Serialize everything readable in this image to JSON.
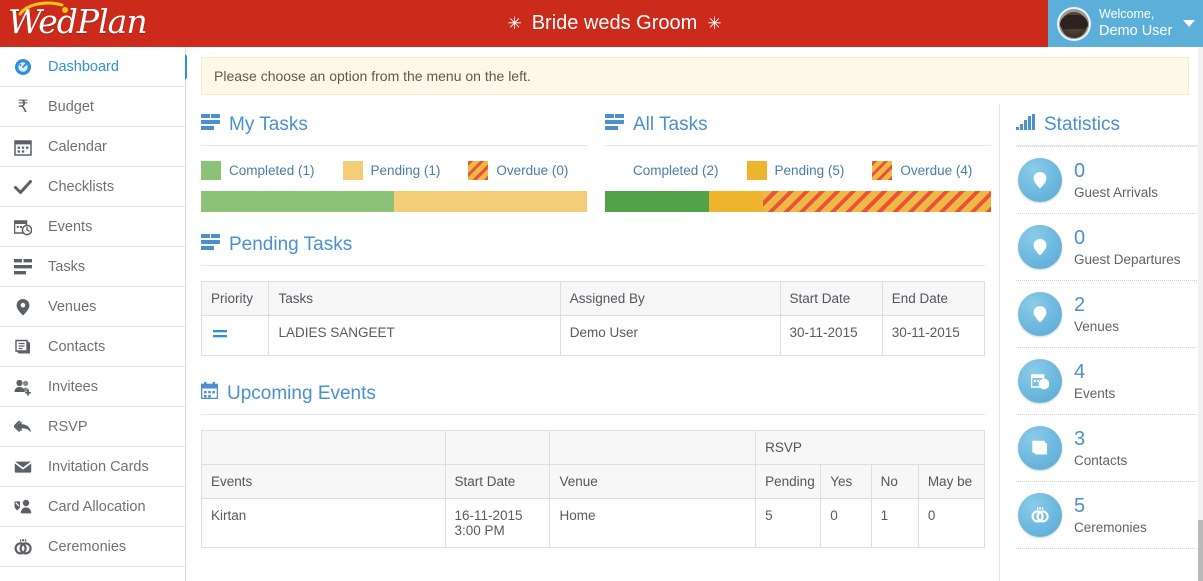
{
  "brand": {
    "logo_text": "WedPlan"
  },
  "header": {
    "banner_text": "Bride weds Groom",
    "sparkle_left": "✳",
    "sparkle_right": "✳",
    "welcome_label": "Welcome,",
    "user_name": "Demo User",
    "accent_red": "#cc2a1a",
    "user_bg_blue": "#5bafd8"
  },
  "sidebar": {
    "items": [
      {
        "label": "Dashboard",
        "icon": "dashboard-icon",
        "active": true
      },
      {
        "label": "Budget",
        "icon": "rupee-icon",
        "active": false
      },
      {
        "label": "Calendar",
        "icon": "calendar-icon",
        "active": false
      },
      {
        "label": "Checklists",
        "icon": "check-icon",
        "active": false
      },
      {
        "label": "Events",
        "icon": "calendar-clock-icon",
        "active": false
      },
      {
        "label": "Tasks",
        "icon": "tasks-list-icon",
        "active": false
      },
      {
        "label": "Venues",
        "icon": "map-pin-icon",
        "active": false
      },
      {
        "label": "Contacts",
        "icon": "address-book-icon",
        "active": false
      },
      {
        "label": "Invitees",
        "icon": "users-add-icon",
        "active": false
      },
      {
        "label": "RSVP",
        "icon": "reply-all-icon",
        "active": false
      },
      {
        "label": "Invitation Cards",
        "icon": "envelope-icon",
        "active": false
      },
      {
        "label": "Card Allocation",
        "icon": "user-share-icon",
        "active": false
      },
      {
        "label": "Ceremonies",
        "icon": "rings-icon",
        "active": false
      }
    ]
  },
  "alert": {
    "message": "Please choose an option from the menu on the left."
  },
  "my_tasks": {
    "title": "My Tasks",
    "icon": "tasks-list-icon",
    "legend": [
      {
        "label": "Completed (1)",
        "color": "#8cc278",
        "style": "solid"
      },
      {
        "label": "Pending (1)",
        "color": "#f3cd77",
        "style": "solid"
      },
      {
        "label": "Overdue (0)",
        "color": "#f0b844",
        "style": "striped"
      }
    ],
    "bar": [
      {
        "name": "completed",
        "percent": 50,
        "color": "#8cc278",
        "style": "solid"
      },
      {
        "name": "pending",
        "percent": 50,
        "color": "#f3cd77",
        "style": "solid"
      },
      {
        "name": "overdue",
        "percent": 0,
        "color": "#f0b844",
        "style": "striped"
      }
    ]
  },
  "all_tasks": {
    "title": "All Tasks",
    "icon": "tasks-list-icon",
    "legend": [
      {
        "label": "Completed (2)",
        "color": "#4fa council",
        "style": "solid"
      },
      {
        "label": "Pending (5)",
        "color": "#efb42e",
        "style": "solid"
      },
      {
        "label": "Overdue (4)",
        "color": "#f0b844",
        "style": "striped"
      }
    ],
    "bar": [
      {
        "name": "completed",
        "percent": 27,
        "color": "#52a247",
        "style": "solid"
      },
      {
        "name": "pending",
        "percent": 14,
        "color": "#efb42e",
        "style": "solid"
      },
      {
        "name": "overdue",
        "percent": 59,
        "color": "#f0b844",
        "style": "striped"
      }
    ]
  },
  "pending_tasks": {
    "title": "Pending Tasks",
    "icon": "tasks-list-icon",
    "columns": [
      "Priority",
      "Tasks",
      "Assigned By",
      "Start Date",
      "End Date"
    ],
    "rows": [
      {
        "priority_icon": "medium-priority-icon",
        "task": "LADIES SANGEET",
        "assigned_by": "Demo User",
        "start_date": "30-11-2015",
        "end_date": "30-11-2015"
      }
    ]
  },
  "upcoming_events": {
    "title": "Upcoming Events",
    "icon": "calendar-icon",
    "group_header": "RSVP",
    "columns": [
      "Events",
      "Start Date",
      "Venue",
      "Pending",
      "Yes",
      "No",
      "May be"
    ],
    "rows": [
      {
        "event": "Kirtan",
        "start_date": "16-11-2015\n3:00 PM",
        "venue": "Home",
        "pending": "5",
        "yes": "0",
        "no": "1",
        "maybe": "0"
      }
    ]
  },
  "statistics": {
    "title": "Statistics",
    "icon": "bar-chart-icon",
    "items": [
      {
        "value": "0",
        "label": "Guest Arrivals",
        "icon": "map-pin-icon"
      },
      {
        "value": "0",
        "label": "Guest Departures",
        "icon": "map-pin-icon"
      },
      {
        "value": "2",
        "label": "Venues",
        "icon": "map-pin-icon"
      },
      {
        "value": "4",
        "label": "Events",
        "icon": "calendar-clock-icon"
      },
      {
        "value": "3",
        "label": "Contacts",
        "icon": "address-book-icon"
      },
      {
        "value": "5",
        "label": "Ceremonies",
        "icon": "rings-icon"
      }
    ]
  }
}
